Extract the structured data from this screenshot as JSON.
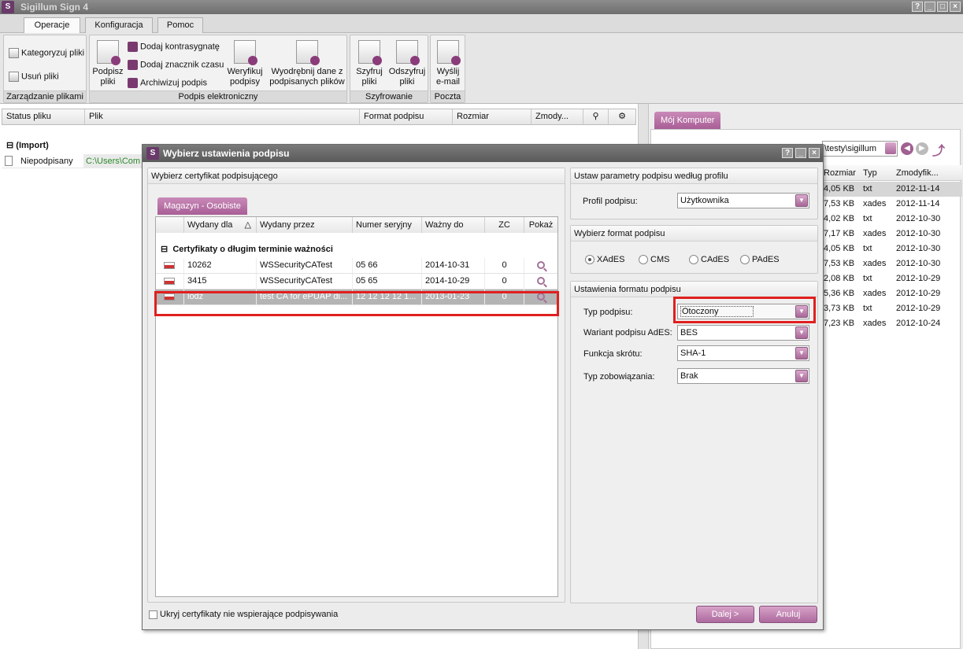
{
  "app": {
    "title": "Sigillum Sign 4",
    "help_btn": "?",
    "min_btn": "_",
    "max_btn": "□",
    "close_btn": "×"
  },
  "ribbon_tabs": [
    {
      "label": "Operacje"
    },
    {
      "label": "Konfiguracja"
    },
    {
      "label": "Pomoc"
    }
  ],
  "ribbon": {
    "groups": {
      "file_mgmt": "Zarządzanie plikami",
      "e_signature": "Podpis elektroniczny",
      "encryption": "Szyfrowanie",
      "mail": "Poczta"
    },
    "categorize": "Kategoryzuj pliki",
    "delete_files": "Usuń pliki",
    "sign_files_1": "Podpisz",
    "sign_files_2": "pliki",
    "add_countersign": "Dodaj kontrasygnatę",
    "add_timestamp": "Dodaj znacznik czasu",
    "archive_sig": "Archiwizuj podpis",
    "verify_1": "Weryfikuj",
    "verify_2": "podpisy",
    "extract_1": "Wyodrębnij dane z",
    "extract_2": "podpisanych plików",
    "encrypt_1": "Szyfruj",
    "encrypt_2": "pliki",
    "decrypt_1": "Odszyfruj",
    "decrypt_2": "pliki",
    "send_1": "Wyślij",
    "send_2": "e-mail"
  },
  "file_list": {
    "columns": [
      "Status pliku",
      "Plik",
      "Format podpisu",
      "Rozmiar",
      "Zmody..."
    ],
    "group": "(Import)",
    "group_toggle": "⊟",
    "row": {
      "status": "Niepodpisany",
      "path": "C:\\Users\\Com"
    }
  },
  "right_panel": {
    "tab": "Mój Komputer",
    "path": "\\testy\\sigillum",
    "columns": [
      "Rozmiar",
      "Typ",
      "Zmodyfik..."
    ],
    "rows": [
      {
        "size": "4,05 KB",
        "type": "txt",
        "date": "2012-11-14"
      },
      {
        "size": "7,53 KB",
        "type": "xades",
        "date": "2012-11-14"
      },
      {
        "size": "4,02 KB",
        "type": "txt",
        "date": "2012-10-30"
      },
      {
        "size": "7,17 KB",
        "type": "xades",
        "date": "2012-10-30"
      },
      {
        "size": "4,05 KB",
        "type": "txt",
        "date": "2012-10-30"
      },
      {
        "size": "7,53 KB",
        "type": "xades",
        "date": "2012-10-30"
      },
      {
        "size": "2,08 KB",
        "type": "txt",
        "date": "2012-10-29"
      },
      {
        "size": "5,36 KB",
        "type": "xades",
        "date": "2012-10-29"
      },
      {
        "size": "3,73 KB",
        "type": "txt",
        "date": "2012-10-29"
      },
      {
        "size": "7,23 KB",
        "type": "xades",
        "date": "2012-10-24"
      }
    ]
  },
  "dialog": {
    "title": "Wybierz ustawienia podpisu",
    "cert_panel": {
      "title": "Wybierz certyfikat podpisującego",
      "store_tab": "Magazyn - Osobiste",
      "columns": [
        "Wydany dla",
        "Wydany przez",
        "Numer seryjny",
        "Ważny do",
        "ZC",
        "Pokaż"
      ],
      "sort_indicator": "△",
      "group": "Certyfikaty o długim terminie ważności",
      "group_toggle": "⊟",
      "rows": [
        {
          "issued_to": "10262",
          "issued_by": "WSSecurityCATest",
          "serial": "05 66",
          "valid_to": "2014-10-31",
          "zc": "0"
        },
        {
          "issued_to": "3415",
          "issued_by": "WSSecurityCATest",
          "serial": "05 65",
          "valid_to": "2014-10-29",
          "zc": "0"
        },
        {
          "issued_to": "lodz",
          "issued_by": "test CA for ePUAP di...",
          "serial": "12 12 12 12 1...",
          "valid_to": "2013-01-23",
          "zc": "0"
        }
      ],
      "hide_unsupported": "Ukryj certyfikaty nie wspierające podpisywania"
    },
    "profile_panel": {
      "title": "Ustaw parametry podpisu według profilu",
      "label": "Profil podpisu:",
      "value": "Użytkownika"
    },
    "format_panel": {
      "title": "Wybierz format podpisu",
      "options": [
        "XAdES",
        "CMS",
        "CAdES",
        "PAdES"
      ],
      "selected": "XAdES"
    },
    "settings_panel": {
      "title": "Ustawienia formatu podpisu",
      "type_label": "Typ podpisu:",
      "type_value": "Otoczony",
      "variant_label": "Wariant podpisu AdES:",
      "variant_value": "BES",
      "hash_label": "Funkcja skrótu:",
      "hash_value": "SHA-1",
      "commit_label": "Typ zobowiązania:",
      "commit_value": "Brak"
    },
    "next_button": "Dalej >",
    "cancel_button": "Anuluj"
  }
}
